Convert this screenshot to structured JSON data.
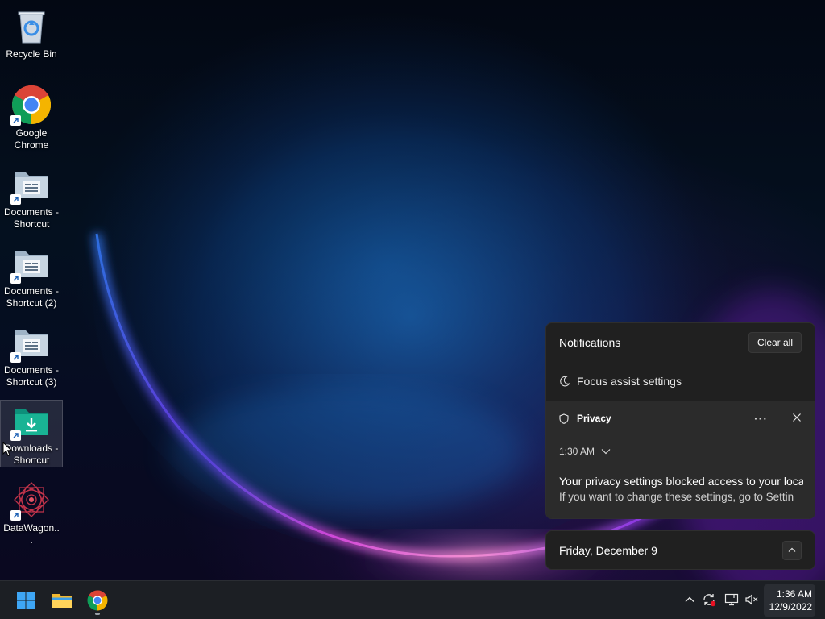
{
  "desktop": {
    "icons": [
      {
        "label": "Recycle Bin",
        "icon": "recycle-bin-icon"
      },
      {
        "label": "Google Chrome",
        "icon": "chrome-icon"
      },
      {
        "label": "Documents - Shortcut",
        "icon": "folder-documents-icon"
      },
      {
        "label": "Documents - Shortcut (2)",
        "icon": "folder-documents-icon"
      },
      {
        "label": "Documents - Shortcut (3)",
        "icon": "folder-documents-icon"
      },
      {
        "label": "Downloads - Shortcut",
        "icon": "folder-downloads-icon",
        "selected": true
      },
      {
        "label": "DataWagon...",
        "icon": "datawagon-icon"
      }
    ]
  },
  "notifications": {
    "title": "Notifications",
    "clear_all": "Clear all",
    "focus_assist": "Focus assist settings",
    "toast": {
      "app": "Privacy",
      "more": "···",
      "time": "1:30 AM",
      "line1": "Your privacy settings blocked access to your locat",
      "line2": "If you want to change these settings, go to Settin"
    }
  },
  "calendar": {
    "date": "Friday, December 9"
  },
  "taskbar": {
    "pinned": [
      "start-icon",
      "file-explorer-icon",
      "chrome-icon"
    ],
    "tray": [
      "chevron-up-icon",
      "sync-icon",
      "network-icon",
      "volume-muted-icon"
    ],
    "clock_time": "1:36 AM",
    "clock_date": "12/9/2022"
  },
  "colors": {
    "panel": "#202020",
    "toast": "#2b2b2b",
    "taskbar": "#1c1f24",
    "accent": "#4cc2ff"
  }
}
